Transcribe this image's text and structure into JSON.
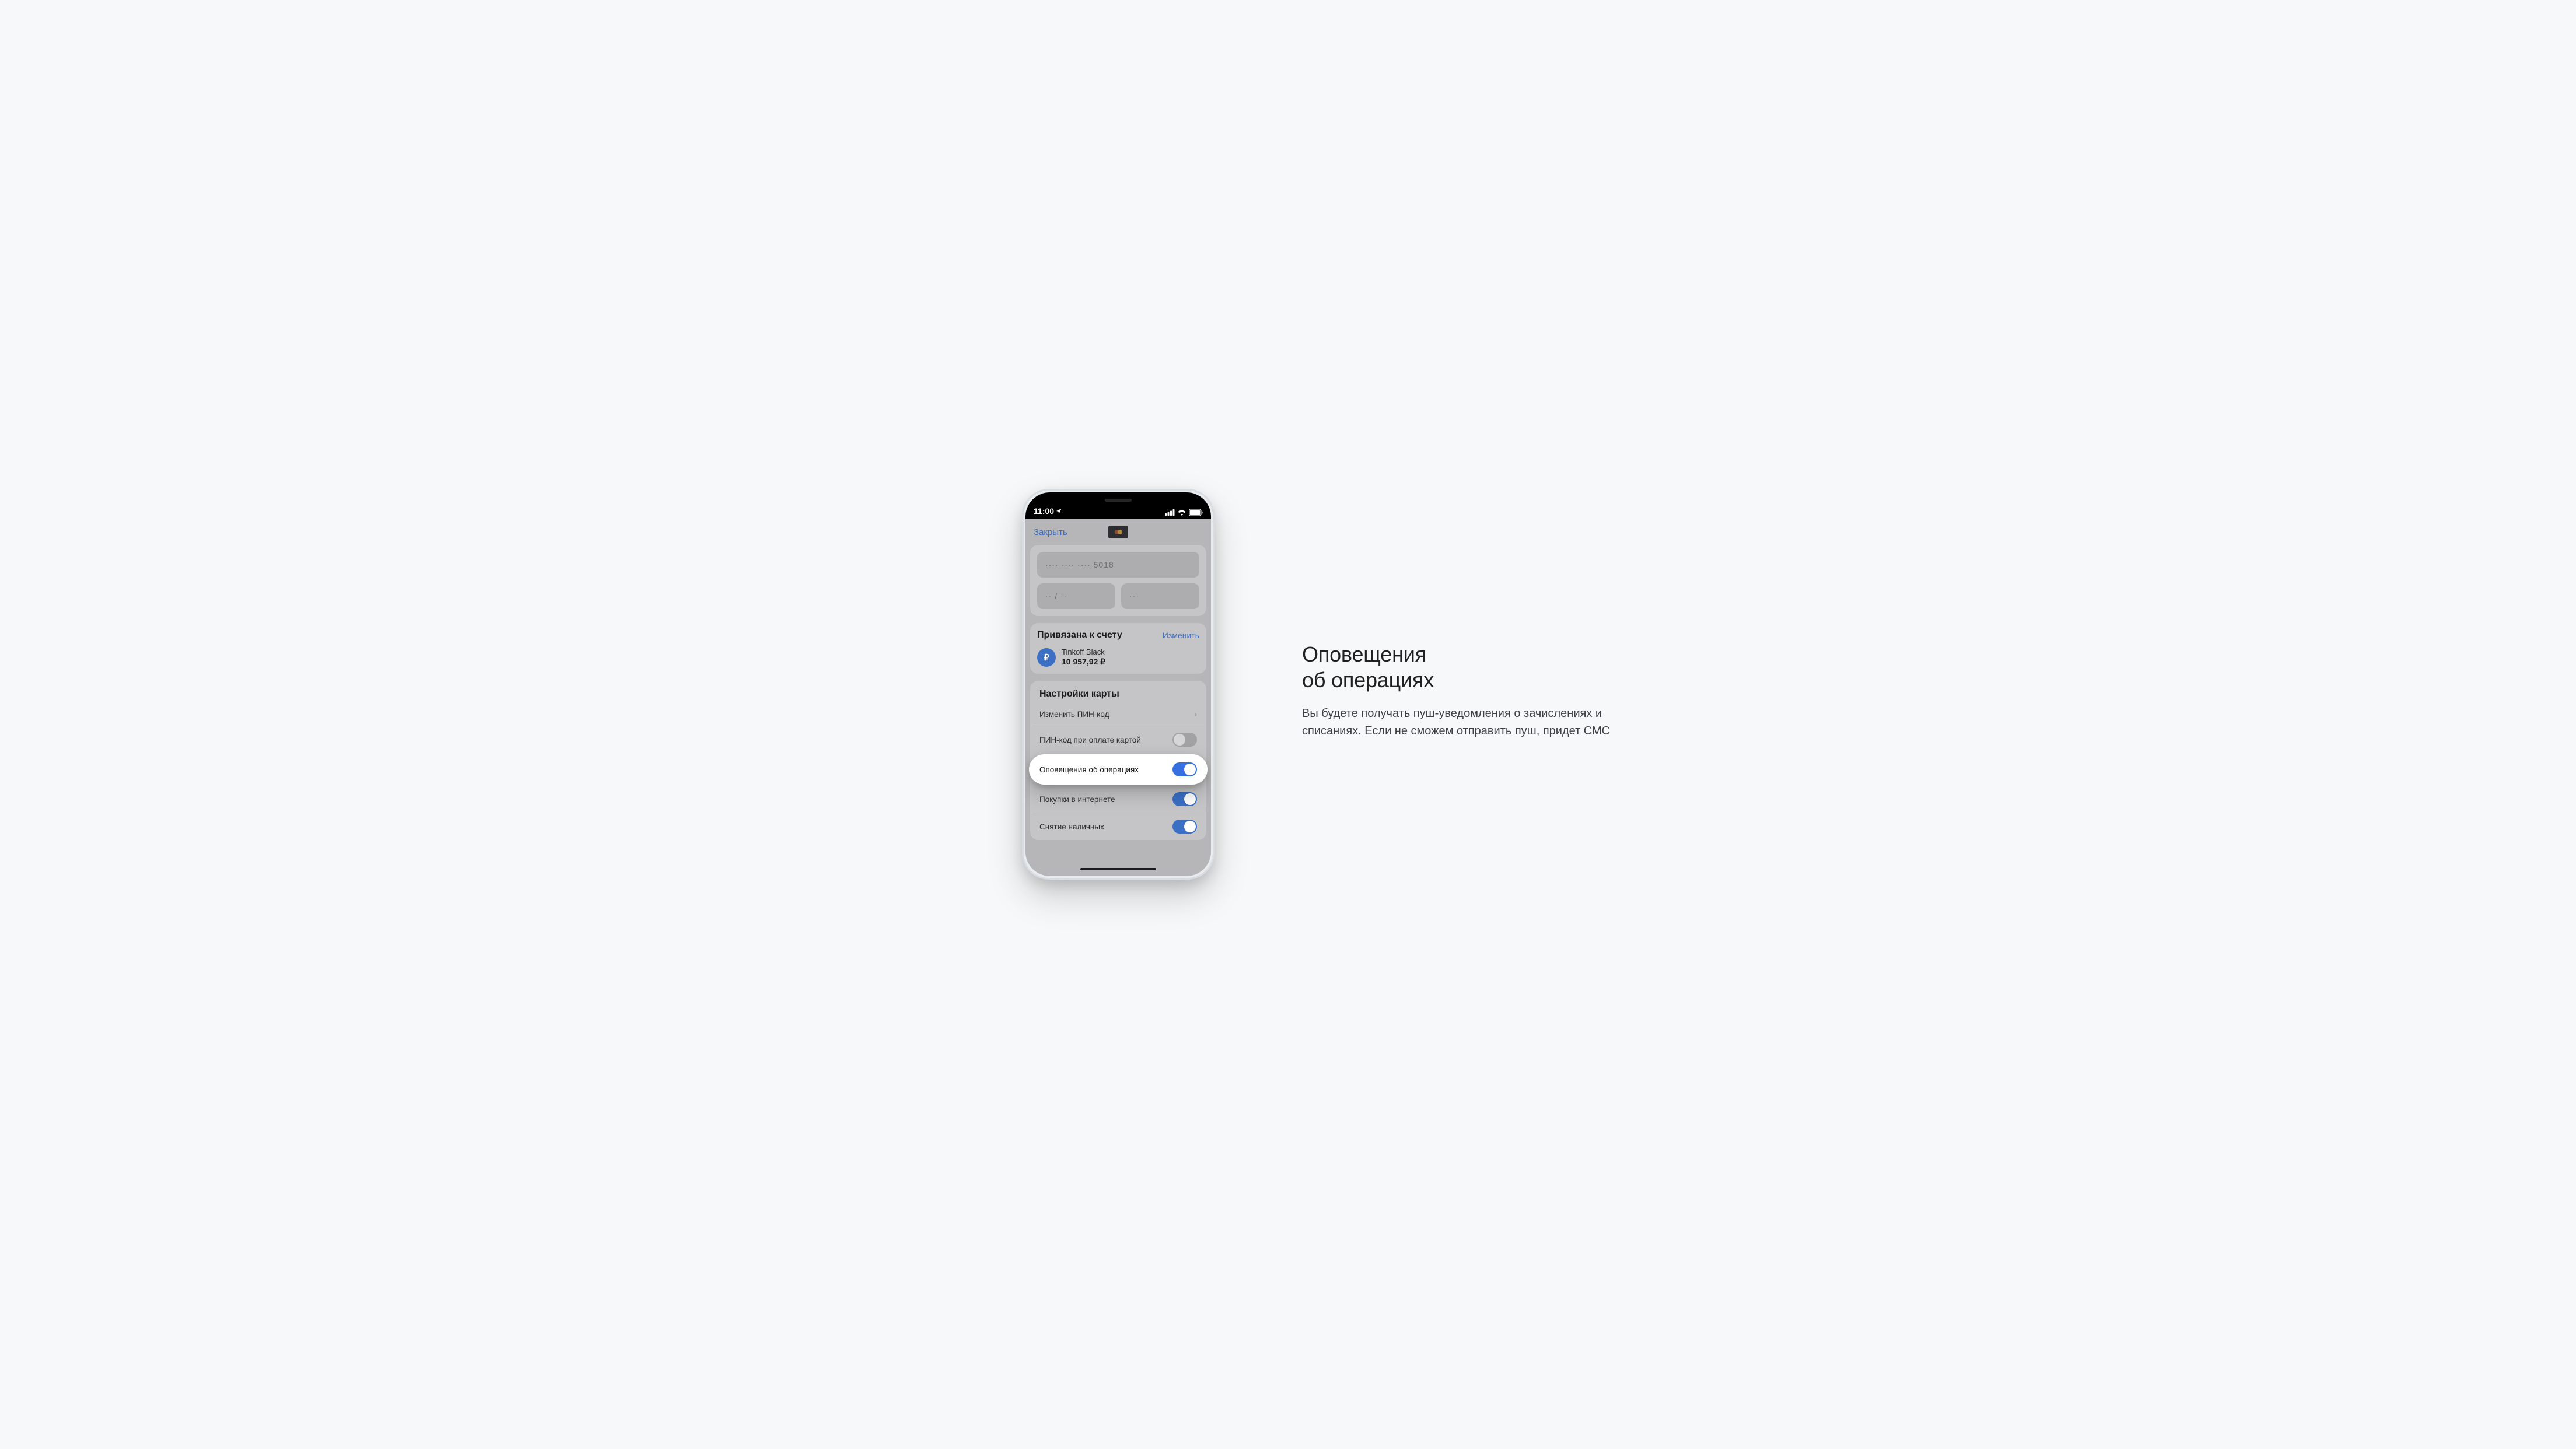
{
  "statusbar": {
    "time": "11:00"
  },
  "nav": {
    "close": "Закрыть"
  },
  "card_number": "····  ····  ···· 5018",
  "card_exp": "·· / ··",
  "card_cvv": "···",
  "linked": {
    "title": "Привязана к счету",
    "change": "Изменить",
    "account_name": "Tinkoff Black",
    "account_balance": "10 957,92 ₽",
    "currency_symbol": "₽"
  },
  "settings": {
    "title": "Настройки карты",
    "rows": {
      "pin": "Изменить ПИН-код",
      "pin_on_pay": "ПИН-код при оплате картой",
      "notifications": "Оповещения об операциях",
      "online": "Покупки в интернете",
      "cash": "Снятие наличных"
    }
  },
  "caption": {
    "h1_line1": "Оповещения",
    "h1_line2": "об операциях",
    "body": "Вы будете получать пуш-уведомления о зачислениях и списаниях. Если не сможем отправить пуш, придет СМС"
  }
}
